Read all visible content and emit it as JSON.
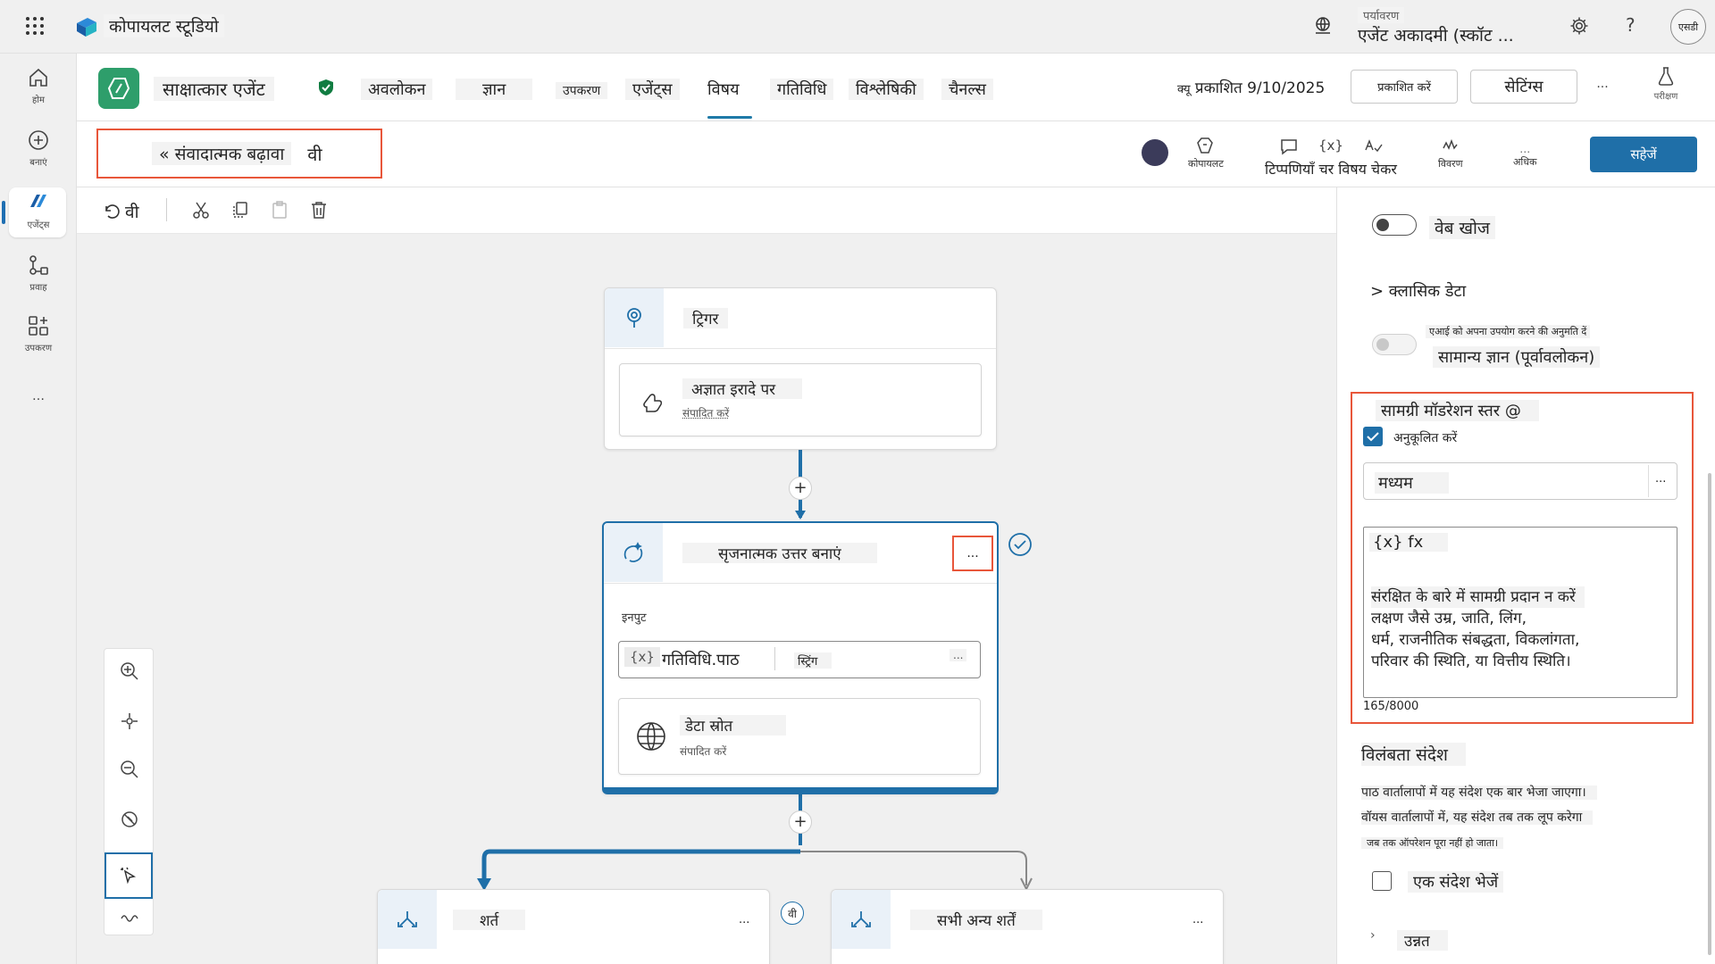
{
  "app": {
    "title": "कोपायलट स्टूडियो",
    "environment_label": "पर्यावरण",
    "environment_value": "एजेंट अकादमी (स्कॉट ...",
    "user_initials": "एसडी"
  },
  "left_rail": [
    {
      "label": "होम"
    },
    {
      "label": "बनाएं"
    },
    {
      "label": "एजेंट्स"
    },
    {
      "label": "प्रवाह"
    },
    {
      "label": "उपकरण"
    }
  ],
  "agent": {
    "name": "साक्षात्कार एजेंट",
    "tabs": [
      {
        "label": "अवलोकन"
      },
      {
        "label": "ज्ञान"
      },
      {
        "label": "उपकरण"
      },
      {
        "label": "एजेंट्स"
      },
      {
        "label": "विषय"
      },
      {
        "label": "गतिविधि"
      },
      {
        "label": "विश्लेषिकी"
      },
      {
        "label": "चैनल्स"
      }
    ],
    "publish_info": "प्रकाशित 9/10/2025",
    "publish_prefix": "क्यू",
    "publish_button": "प्रकाशित करें",
    "settings_button": "सेटिंग्स",
    "more": "...",
    "test_label": "परीक्षण"
  },
  "topic": {
    "name": "« संवादात्मक बढ़ावा",
    "name_suffix": "वी",
    "tools": [
      {
        "label": "कोपायलट"
      },
      {
        "label": "टिप्पणियाँ चर विषय चेकर"
      },
      {
        "label": "विवरण"
      },
      {
        "label": "अधिक"
      }
    ],
    "save_button": "सहेजें",
    "undo_label": "वी"
  },
  "canvas": {
    "trigger_title": "ट्रिगर",
    "trigger_card_title": "अज्ञात इरादे पर",
    "trigger_card_sub": "संपादित करें",
    "gen_title": "सृजनात्मक उत्तर बनाएं",
    "gen_more": "...",
    "input_label": "इनपुट",
    "input_var_prefix": "{x}",
    "input_var": "गतिविधि.पाठ",
    "input_type": "स्ट्रिंग",
    "input_more": "...",
    "datasource_title": "डेटा स्रोत",
    "datasource_sub": "संपादित करें",
    "condition_title": "शर्त",
    "condition_more": "...",
    "other_title": "सभी अन्य शर्तें",
    "other_more": "...",
    "branch_badge": "वी"
  },
  "properties": {
    "web_search": "वेब खोज",
    "classic_data": "> क्लासिक डेटा",
    "ai_allow": "एआई को अपना उपयोग करने की अनुमति दें",
    "general_knowledge": "सामान्य ज्ञान (पूर्वावलोकन)",
    "moderation_title": "सामग्री मॉडरेशन स्तर @",
    "customize": "अनुकूलित करें",
    "moderation_value": "मध्यम",
    "select_more": "...",
    "fx_label": "{x} fx",
    "prompt_lines": [
      "संरक्षित के बारे में सामग्री प्रदान न करें",
      "लक्षण जैसे उम्र, जाति, लिंग,",
      "धर्म, राजनीतिक संबद्धता, विकलांगता,",
      "परिवार की स्थिति, या वित्तीय स्थिति।"
    ],
    "char_count": "165/8000",
    "delay_title": "विलंबता संदेश",
    "delay_lines": [
      "पाठ वार्तालापों में यह संदेश एक बार भेजा जाएगा।",
      "वॉयस वार्तालापों में, यह संदेश तब तक लूप करेगा",
      "जब तक ऑपरेशन पूरा नहीं हो जाता।"
    ],
    "send_message": "एक संदेश भेजें",
    "advanced": "उन्नत"
  }
}
